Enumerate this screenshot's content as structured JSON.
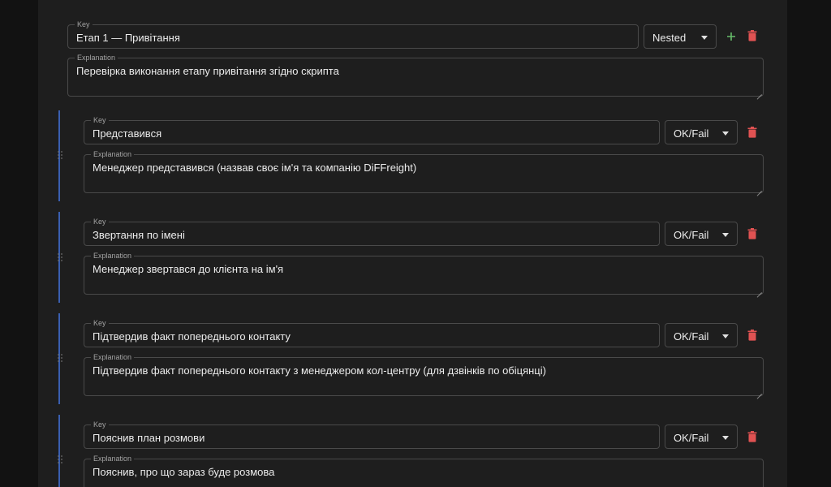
{
  "labels": {
    "key": "Key",
    "explanation": "Explanation"
  },
  "parent": {
    "key_value": "Етап 1 — Привітання",
    "type": "Nested",
    "explanation": "Перевірка виконання етапу привітання згідно скрипта"
  },
  "children": [
    {
      "key_value": "Представився",
      "type": "OK/Fail",
      "explanation": "Менеджер представився (назвав своє ім'я та компанію DiFFreight)"
    },
    {
      "key_value": "Звертання по імені",
      "type": "OK/Fail",
      "explanation": "Менеджер звертався до клієнта на ім'я"
    },
    {
      "key_value": "Підтвердив факт попереднього контакту",
      "type": "OK/Fail",
      "explanation": "Підтвердив факт попереднього контакту з менеджером кол-центру (для дзвінків по обіцянці)"
    },
    {
      "key_value": "Пояснив план розмови",
      "type": "OK/Fail",
      "explanation": "Пояснив, про що зараз буде розмова"
    }
  ],
  "colors": {
    "accent_bar": "#3a5fb0",
    "add": "#66bb6a",
    "delete": "#e05252"
  },
  "icons": {
    "add": "plus-icon",
    "delete": "trash-icon",
    "drag": "drag-handle-icon",
    "dropdown": "chevron-down-icon"
  }
}
